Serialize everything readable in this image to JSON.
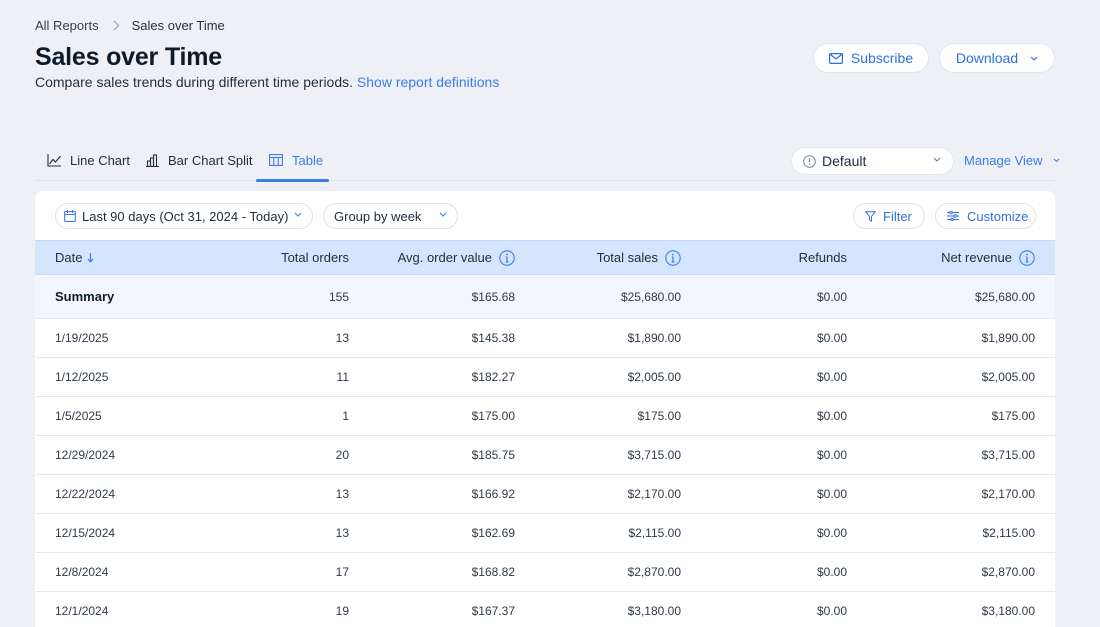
{
  "breadcrumb": {
    "parent": "All Reports",
    "current": "Sales over Time"
  },
  "header": {
    "title": "Sales over Time",
    "subtitle": "Compare sales trends during different time periods.",
    "definitions_link": "Show report definitions",
    "subscribe_label": "Subscribe",
    "download_label": "Download"
  },
  "tabs": [
    {
      "label": "Line Chart",
      "icon": "line-chart-icon",
      "active": false
    },
    {
      "label": "Bar Chart Split",
      "icon": "bar-chart-icon",
      "active": false
    },
    {
      "label": "Table",
      "icon": "table-icon",
      "active": true
    }
  ],
  "view": {
    "selected": "Default",
    "manage_label": "Manage View"
  },
  "filters": {
    "date_range": "Last 90 days (Oct 31, 2024 - Today)",
    "group_by": "Group by week",
    "filter_label": "Filter",
    "customize_label": "Customize"
  },
  "colors": {
    "accent": "#3b7ded",
    "header_bg": "#d5e5fd",
    "page_bg": "#eff0f5"
  },
  "table": {
    "columns": [
      "Date",
      "Total orders",
      "Avg. order value",
      "Total sales",
      "Refunds",
      "Net revenue"
    ],
    "sort": {
      "column": "Date",
      "direction": "descending"
    },
    "summary": {
      "label": "Summary",
      "total_orders": "155",
      "avg_order_value": "$165.68",
      "total_sales": "$25,680.00",
      "refunds": "$0.00",
      "net_revenue": "$25,680.00"
    },
    "rows": [
      {
        "date": "1/19/2025",
        "total_orders": "13",
        "avg_order_value": "$145.38",
        "total_sales": "$1,890.00",
        "refunds": "$0.00",
        "net_revenue": "$1,890.00"
      },
      {
        "date": "1/12/2025",
        "total_orders": "11",
        "avg_order_value": "$182.27",
        "total_sales": "$2,005.00",
        "refunds": "$0.00",
        "net_revenue": "$2,005.00"
      },
      {
        "date": "1/5/2025",
        "total_orders": "1",
        "avg_order_value": "$175.00",
        "total_sales": "$175.00",
        "refunds": "$0.00",
        "net_revenue": "$175.00"
      },
      {
        "date": "12/29/2024",
        "total_orders": "20",
        "avg_order_value": "$185.75",
        "total_sales": "$3,715.00",
        "refunds": "$0.00",
        "net_revenue": "$3,715.00"
      },
      {
        "date": "12/22/2024",
        "total_orders": "13",
        "avg_order_value": "$166.92",
        "total_sales": "$2,170.00",
        "refunds": "$0.00",
        "net_revenue": "$2,170.00"
      },
      {
        "date": "12/15/2024",
        "total_orders": "13",
        "avg_order_value": "$162.69",
        "total_sales": "$2,115.00",
        "refunds": "$0.00",
        "net_revenue": "$2,115.00"
      },
      {
        "date": "12/8/2024",
        "total_orders": "17",
        "avg_order_value": "$168.82",
        "total_sales": "$2,870.00",
        "refunds": "$0.00",
        "net_revenue": "$2,870.00"
      },
      {
        "date": "12/1/2024",
        "total_orders": "19",
        "avg_order_value": "$167.37",
        "total_sales": "$3,180.00",
        "refunds": "$0.00",
        "net_revenue": "$3,180.00"
      }
    ]
  }
}
